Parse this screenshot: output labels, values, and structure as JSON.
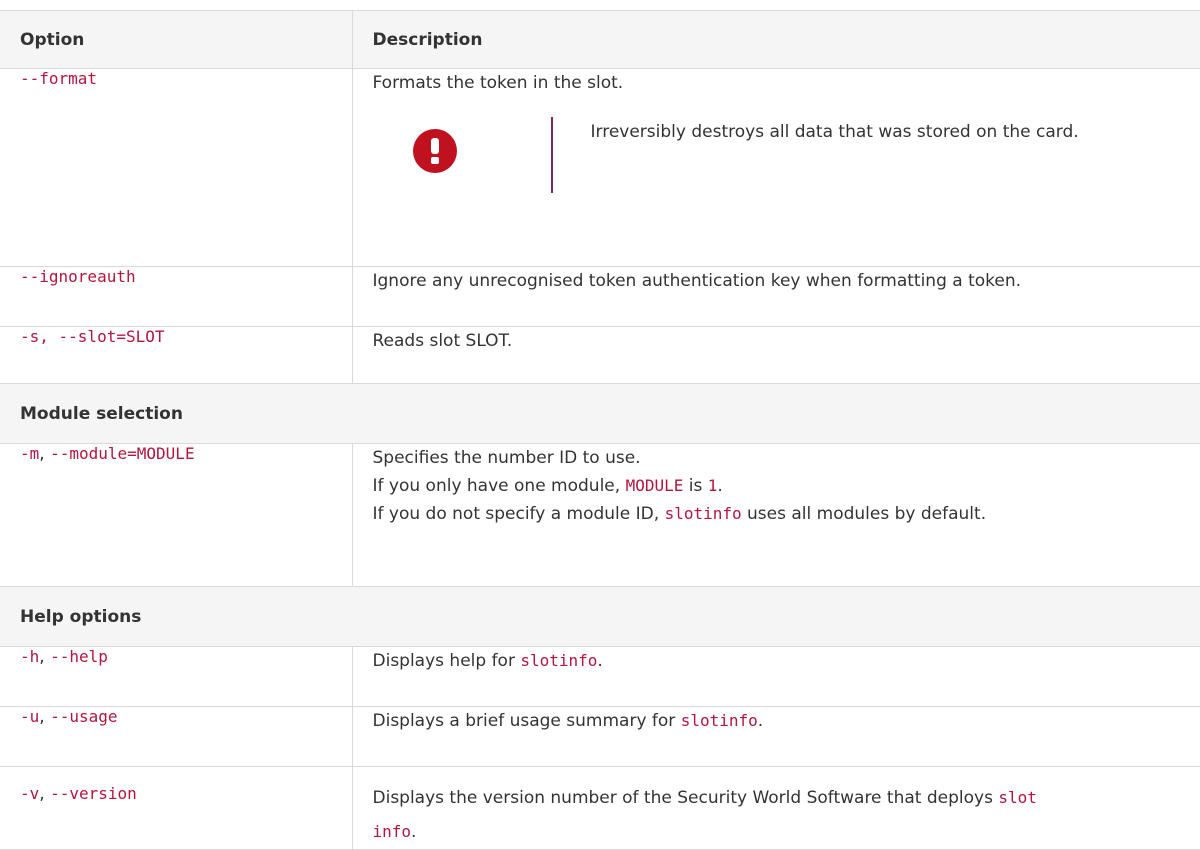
{
  "table": {
    "headers": {
      "option": "Option",
      "description": "Description"
    },
    "rows": {
      "format": {
        "option": "--format",
        "description": "Formats the token in the slot.",
        "warning": "Irreversibly destroys all data that was stored on the card.",
        "warning_icon": "warning-exclamation-icon"
      },
      "ignoreauth": {
        "option": "--ignoreauth",
        "description": "Ignore any unrecognised token authentication key when formatting a token."
      },
      "slot": {
        "option": "-s, --slot=SLOT",
        "description": "Reads slot SLOT."
      }
    },
    "sections": {
      "module": "Module selection",
      "help": "Help options"
    },
    "module_row": {
      "opt_short": "-m",
      "sep": ", ",
      "opt_long": "--module=MODULE",
      "line1": "Specifies the number ID to use.",
      "line2_pre": "If you only have one module, ",
      "line2_code1": "MODULE",
      "line2_mid": " is ",
      "line2_code2": "1",
      "line2_post": ".",
      "line3_pre": "If you do not specify a module ID, ",
      "line3_code": "slotinfo",
      "line3_post": " uses all modules by default."
    },
    "help_rows": {
      "help": {
        "opt_short": "-h",
        "sep": ", ",
        "opt_long": "--help",
        "desc_pre": "Displays help for ",
        "desc_code": "slotinfo",
        "desc_post": "."
      },
      "usage": {
        "opt_short": "-u",
        "sep": ", ",
        "opt_long": "--usage",
        "desc_pre": "Displays a brief usage summary for ",
        "desc_code": "slotinfo",
        "desc_post": "."
      },
      "version": {
        "opt_short": "-v",
        "sep": ", ",
        "opt_long": "--version",
        "desc_pre": "Displays the version number of the Security World Software that deploys ",
        "desc_code_a": "slot",
        "desc_code_b": "info",
        "desc_post": "."
      }
    }
  },
  "colors": {
    "code": "#b5153c",
    "warning_icon": "#c0111f",
    "warning_rule": "#7a2a55",
    "header_bg": "#f5f5f5",
    "border": "#d9d9d9"
  }
}
